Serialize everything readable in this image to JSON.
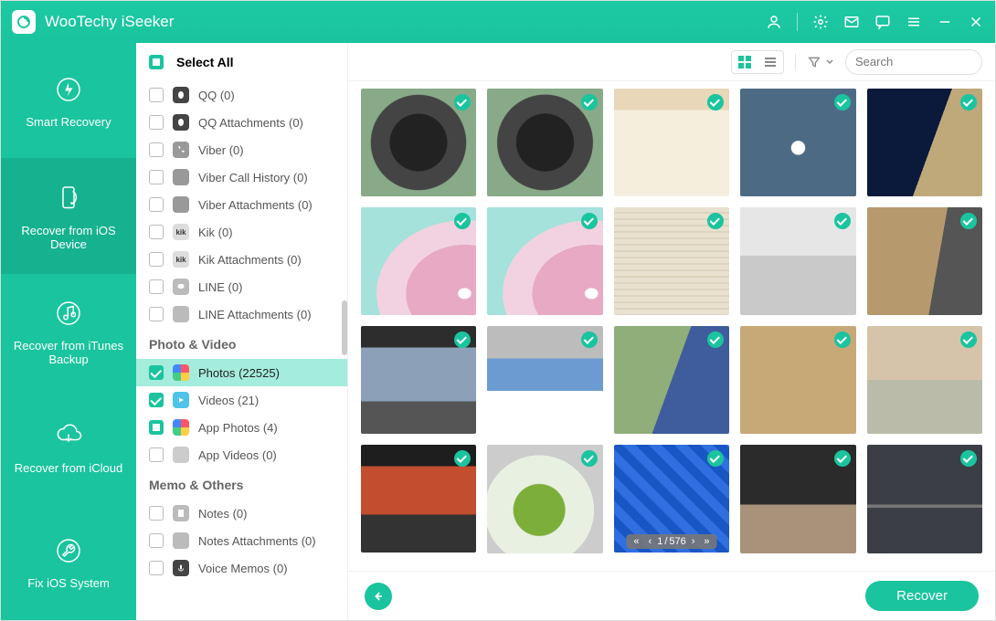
{
  "app": {
    "title": "WooTechy iSeeker"
  },
  "titlebar_icons": [
    "user-icon",
    "gear-icon",
    "mail-icon",
    "chat-icon",
    "menu-icon",
    "minimize-icon",
    "close-icon"
  ],
  "sidebar": {
    "items": [
      {
        "name": "smart-recovery",
        "label": "Smart Recovery",
        "icon": "bolt"
      },
      {
        "name": "recover-ios-device",
        "label": "Recover from iOS Device",
        "icon": "phone"
      },
      {
        "name": "recover-itunes-backup",
        "label": "Recover from iTunes Backup",
        "icon": "music"
      },
      {
        "name": "recover-icloud",
        "label": "Recover from iCloud",
        "icon": "cloud"
      },
      {
        "name": "fix-ios-system",
        "label": "Fix iOS System",
        "icon": "wrench"
      }
    ],
    "active_index": 1
  },
  "panel": {
    "select_all_label": "Select All",
    "select_all_state": "half",
    "categories": [
      {
        "icon": "qq",
        "label": "QQ (0)",
        "checked": ""
      },
      {
        "icon": "qq",
        "label": "QQ Attachments (0)",
        "checked": ""
      },
      {
        "icon": "viber",
        "label": "Viber (0)",
        "checked": ""
      },
      {
        "icon": "viber",
        "label": "Viber Call History (0)",
        "checked": ""
      },
      {
        "icon": "viber",
        "label": "Viber Attachments (0)",
        "checked": ""
      },
      {
        "icon": "kik",
        "label": "Kik (0)",
        "checked": ""
      },
      {
        "icon": "kik",
        "label": "Kik Attachments (0)",
        "checked": ""
      },
      {
        "icon": "line",
        "label": "LINE (0)",
        "checked": ""
      },
      {
        "icon": "line",
        "label": "LINE Attachments (0)",
        "checked": ""
      }
    ],
    "section_photo_video_label": "Photo & Video",
    "photo_video": [
      {
        "icon": "photos",
        "label": "Photos (22525)",
        "checked": "checked",
        "active": true
      },
      {
        "icon": "videos",
        "label": "Videos (21)",
        "checked": "checked"
      },
      {
        "icon": "app-photos",
        "label": "App Photos (4)",
        "checked": "half"
      },
      {
        "icon": "app-videos",
        "label": "App Videos (0)",
        "checked": ""
      }
    ],
    "section_memo_label": "Memo & Others",
    "memo": [
      {
        "icon": "notes",
        "label": "Notes (0)",
        "checked": ""
      },
      {
        "icon": "notes",
        "label": "Notes Attachments (0)",
        "checked": ""
      },
      {
        "icon": "voice",
        "label": "Voice Memos (0)",
        "checked": ""
      }
    ]
  },
  "toolbar": {
    "search_placeholder": "Search",
    "active_view": "grid"
  },
  "grid": {
    "count": 20,
    "pager": {
      "page": "1",
      "total": "576"
    }
  },
  "footer": {
    "recover_label": "Recover"
  }
}
